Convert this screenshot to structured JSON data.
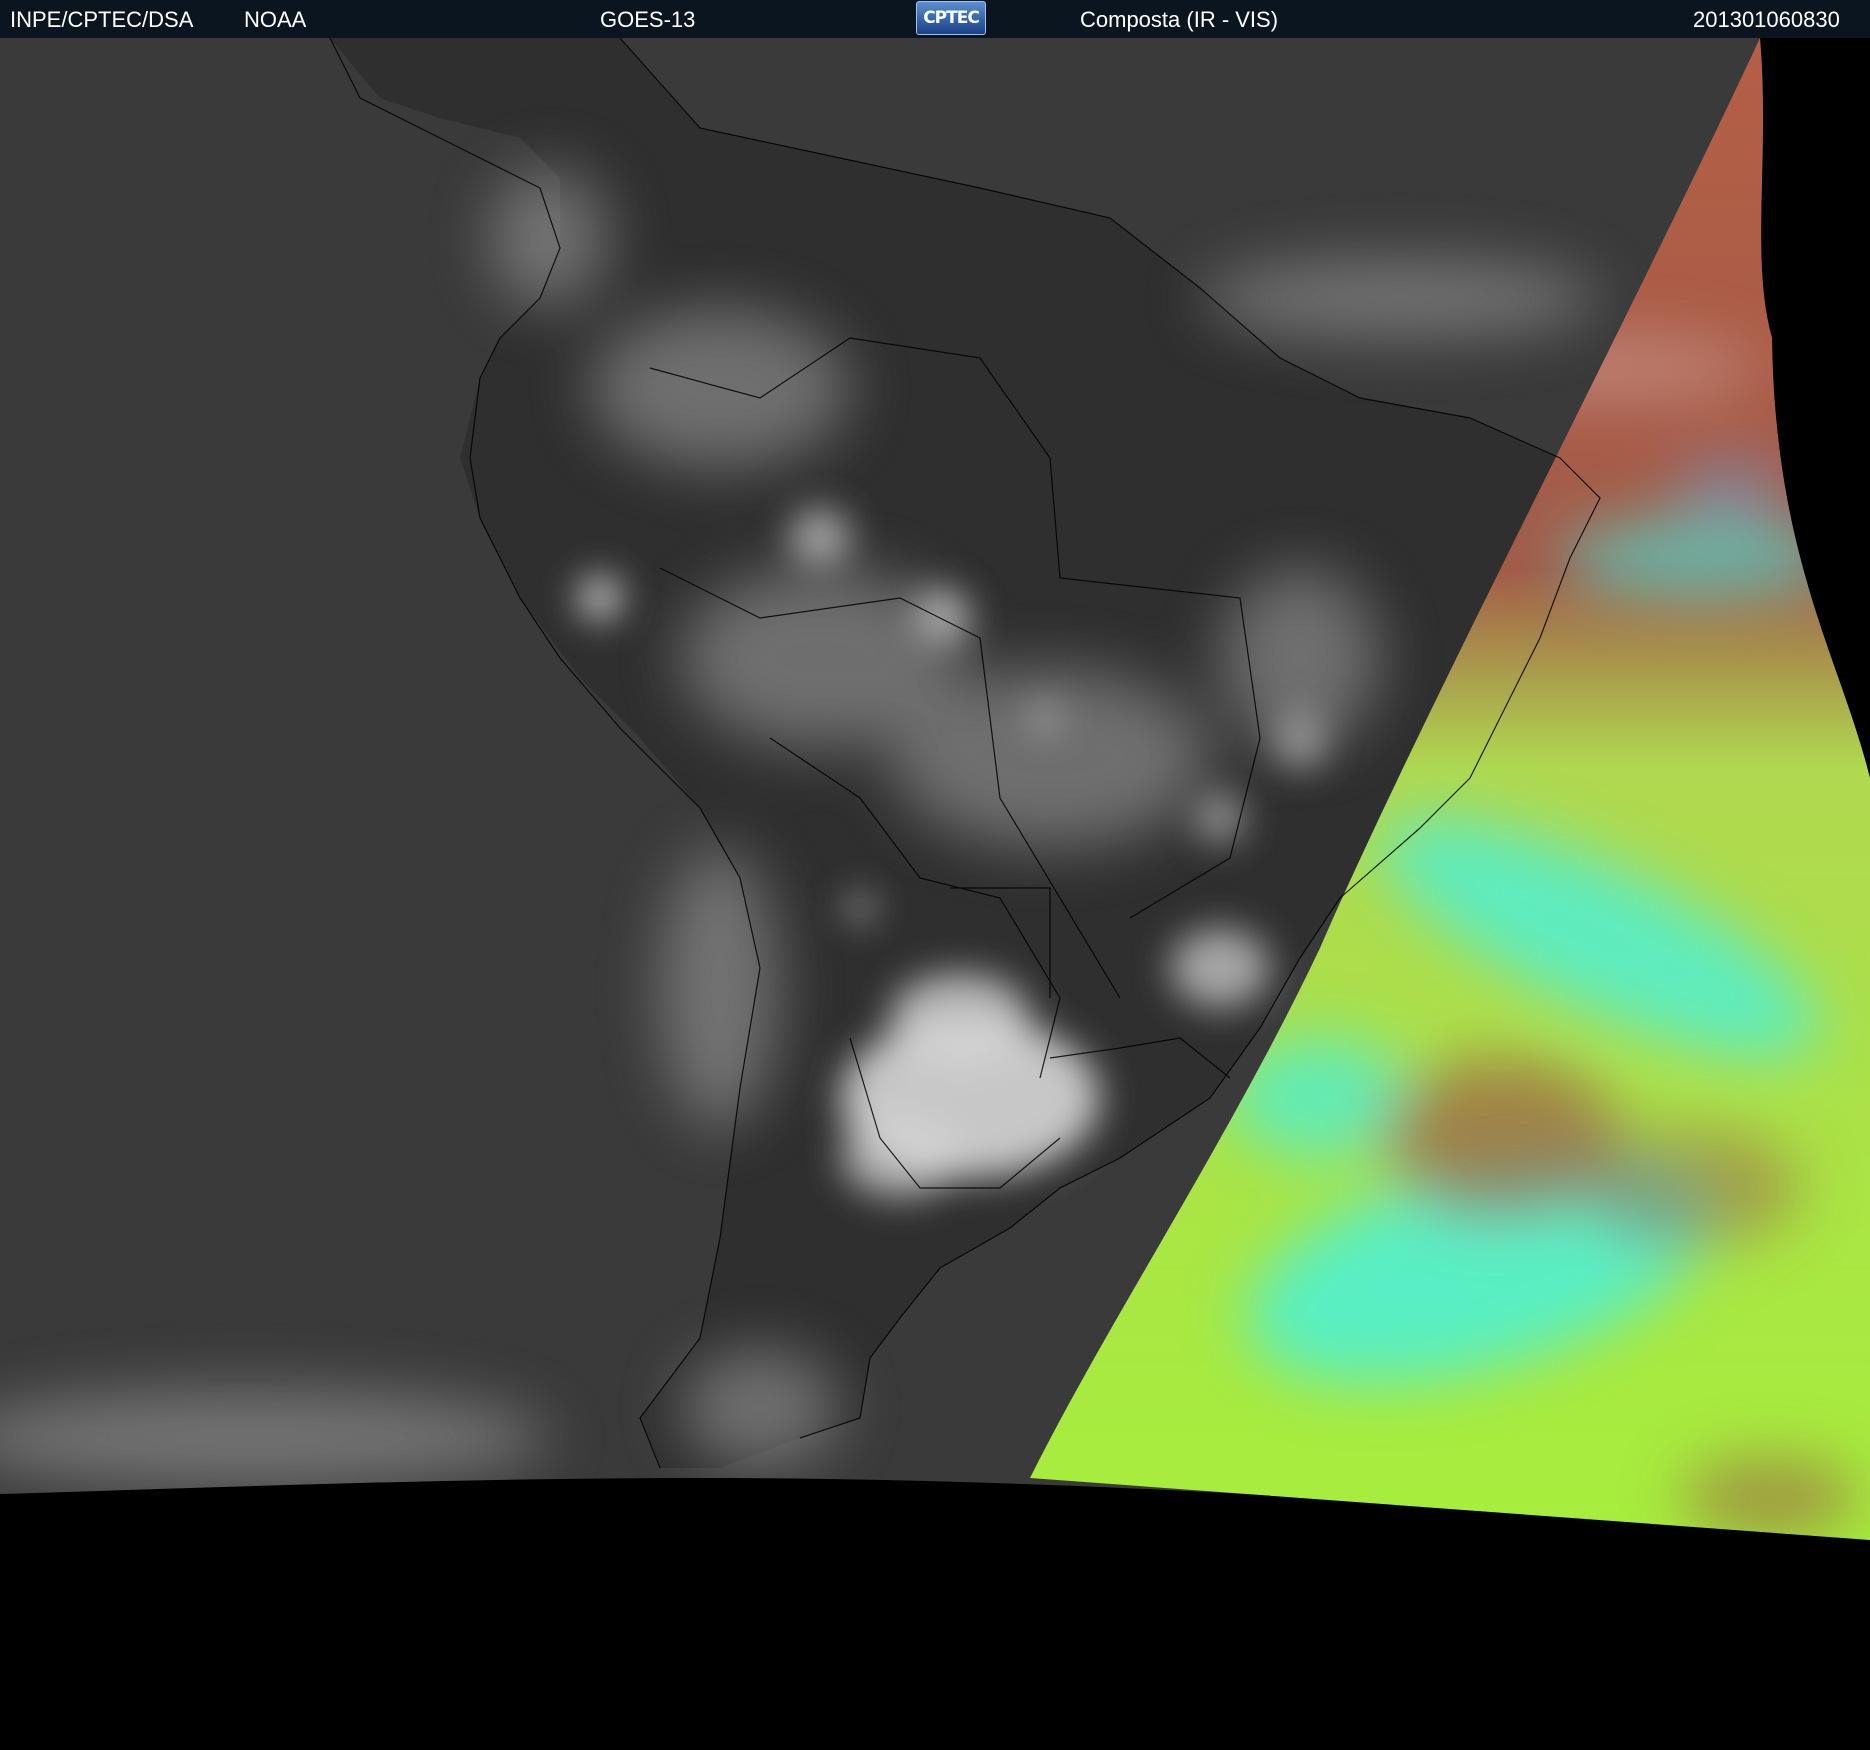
{
  "header": {
    "agency": "INPE/CPTEC/DSA",
    "source": "NOAA",
    "satellite": "GOES-13",
    "logo_text": "CPTEC",
    "product": "Composta (IR - VIS)",
    "timestamp": "201301060830"
  },
  "colors": {
    "header_bg": "#0a1520",
    "ir_dark": "#3a3a3a",
    "ir_cloud": "#d8d8d8",
    "vis_green": "#a6ef3c",
    "vis_cyan": "#44f0e4",
    "vis_brown": "#9a5a46",
    "space": "#000000",
    "borders": "#000000"
  }
}
